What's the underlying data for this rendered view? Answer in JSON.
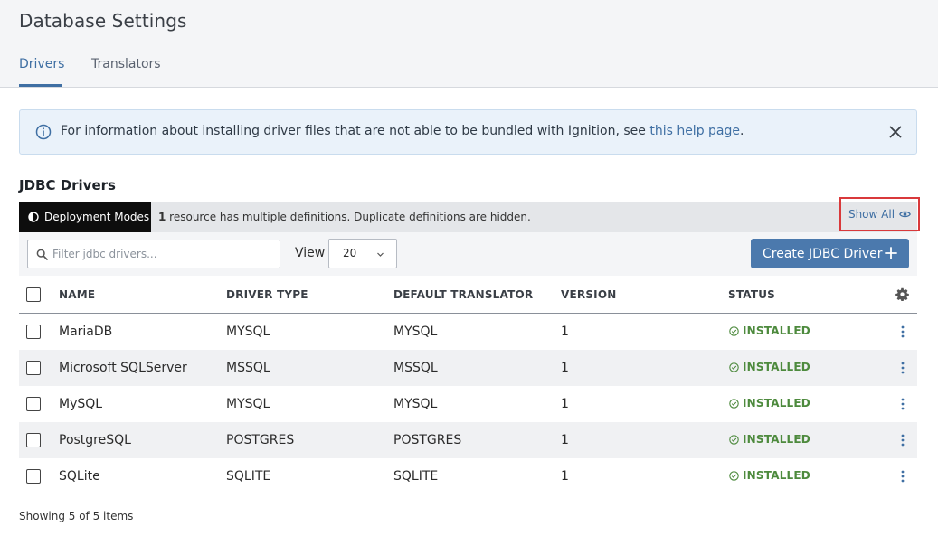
{
  "header": {
    "title": "Database Settings",
    "tabs": [
      {
        "label": "Drivers",
        "active": true
      },
      {
        "label": "Translators",
        "active": false
      }
    ]
  },
  "banner": {
    "text_before": "For information about installing driver files that are not able to be bundled with Ignition, see ",
    "link_text": "this help page",
    "text_after": ".",
    "icon": "info-circle-icon",
    "close_icon": "close-icon"
  },
  "section": {
    "title": "JDBC Drivers"
  },
  "mode_bar": {
    "badge_label": "Deployment Modes",
    "count": "1",
    "message": " resource has multiple definitions. Duplicate definitions are hidden.",
    "show_all_label": "Show All"
  },
  "toolbar": {
    "filter_placeholder": "Filter jdbc drivers...",
    "view_label": "View",
    "view_value": "20",
    "create_label": "Create JDBC Driver"
  },
  "table": {
    "columns": [
      "NAME",
      "DRIVER TYPE",
      "DEFAULT TRANSLATOR",
      "VERSION",
      "STATUS"
    ],
    "rows": [
      {
        "name": "MariaDB",
        "driver_type": "MYSQL",
        "translator": "MYSQL",
        "version": "1",
        "status": "INSTALLED"
      },
      {
        "name": "Microsoft SQLServer",
        "driver_type": "MSSQL",
        "translator": "MSSQL",
        "version": "1",
        "status": "INSTALLED"
      },
      {
        "name": "MySQL",
        "driver_type": "MYSQL",
        "translator": "MYSQL",
        "version": "1",
        "status": "INSTALLED"
      },
      {
        "name": "PostgreSQL",
        "driver_type": "POSTGRES",
        "translator": "POSTGRES",
        "version": "1",
        "status": "INSTALLED"
      },
      {
        "name": "SQLite",
        "driver_type": "SQLITE",
        "translator": "SQLITE",
        "version": "1",
        "status": "INSTALLED"
      }
    ]
  },
  "footer": {
    "summary": "Showing 5 of 5 items"
  },
  "colors": {
    "accent": "#3f6fa3",
    "primary_button": "#4b79ad",
    "status_ok": "#4d8a3d",
    "highlight_border": "#d9393b"
  }
}
